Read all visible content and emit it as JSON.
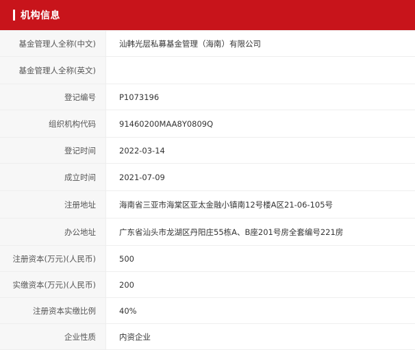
{
  "header": {
    "title": "机构信息",
    "accent_color": "#c8141b"
  },
  "rows": [
    {
      "label": "基金管理人全称(中文)",
      "value": "汕韩光层私募基金管理（海南）有限公司"
    },
    {
      "label": "基金管理人全称(英文)",
      "value": ""
    },
    {
      "label": "登记编号",
      "value": "P1073196"
    },
    {
      "label": "组织机构代码",
      "value": "91460200MAA8Y0809Q"
    },
    {
      "label": "登记时间",
      "value": "2022-03-14"
    },
    {
      "label": "成立时间",
      "value": "2021-07-09"
    },
    {
      "label": "注册地址",
      "value": "海南省三亚市海棠区亚太金融小镇南12号楼A区21-06-105号"
    },
    {
      "label": "办公地址",
      "value": "广东省汕头市龙湖区丹阳庄55栋A、B座201号房全套编号221房"
    },
    {
      "label": "注册资本(万元)(人民币)",
      "value": "500"
    },
    {
      "label": "实缴资本(万元)(人民币)",
      "value": "200"
    },
    {
      "label": "注册资本实缴比例",
      "value": "40%"
    },
    {
      "label": "企业性质",
      "value": "内资企业"
    }
  ]
}
